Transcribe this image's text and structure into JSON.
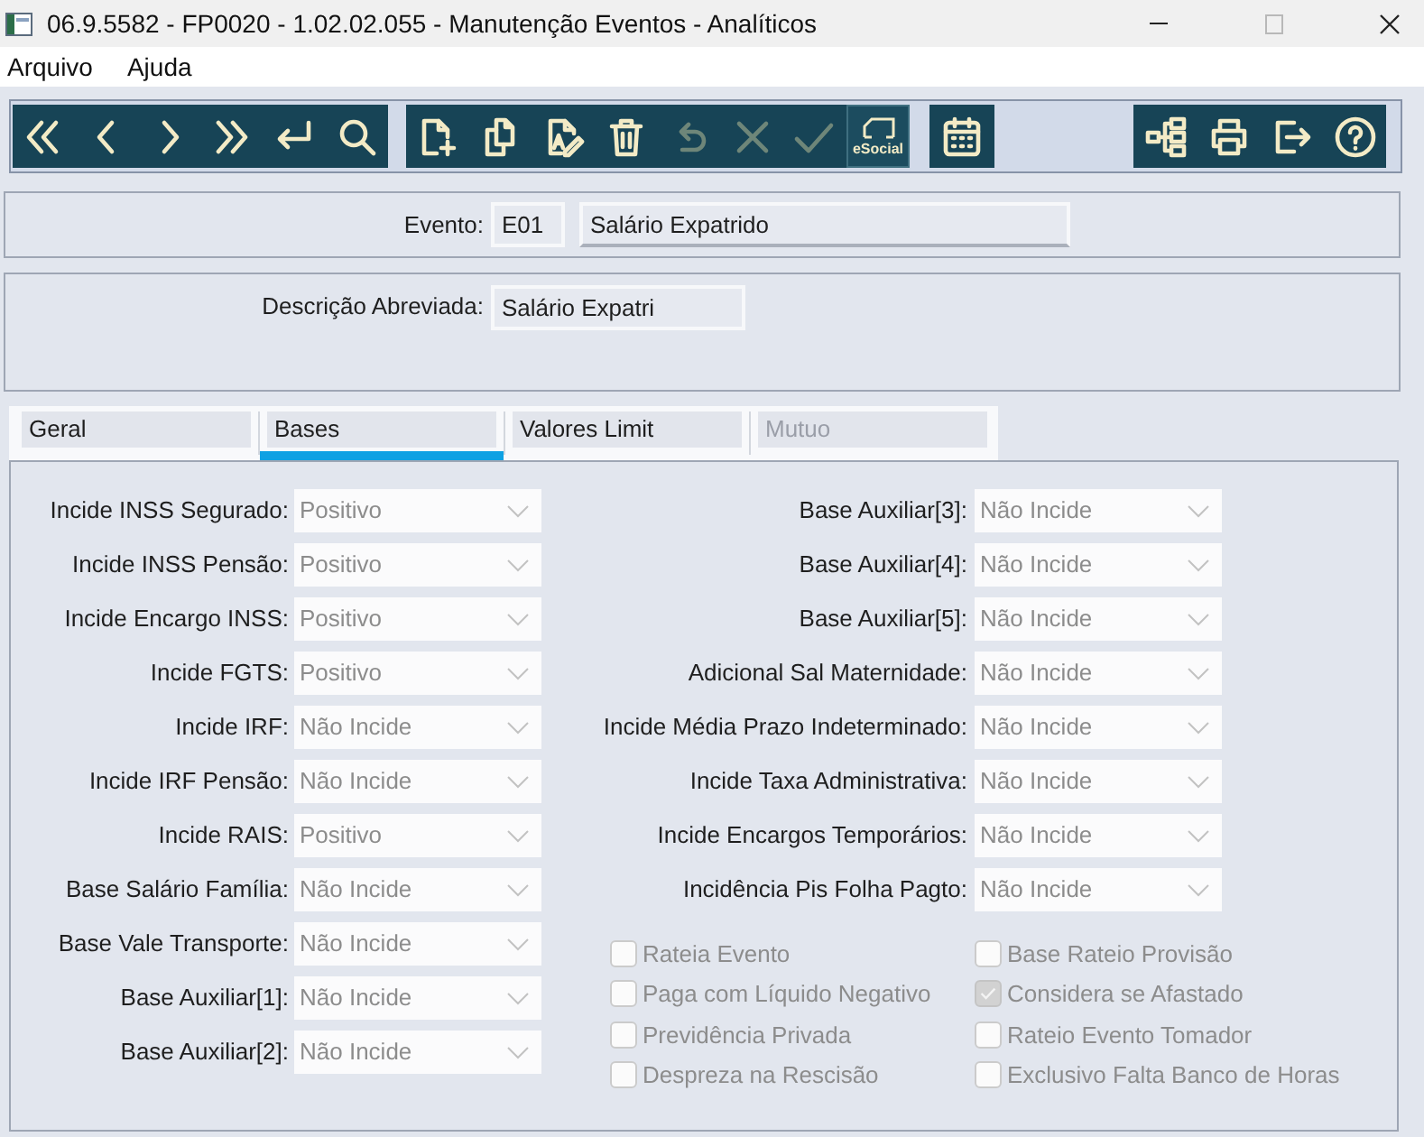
{
  "window": {
    "title": "06.9.5582 - FP0020 - 1.02.02.055 - Manutenção Eventos - Analíticos"
  },
  "menu": [
    "Arquivo",
    "Ajuda"
  ],
  "toolbar": {
    "groups": [
      {
        "buttons": [
          {
            "kind": "first",
            "disabled": false
          },
          {
            "kind": "previous",
            "disabled": false
          },
          {
            "kind": "next",
            "disabled": false
          },
          {
            "kind": "last",
            "disabled": false
          },
          {
            "kind": "enter",
            "disabled": false
          },
          {
            "kind": "search",
            "disabled": false
          }
        ]
      },
      {
        "buttons": [
          {
            "kind": "new",
            "disabled": false
          },
          {
            "kind": "copy",
            "disabled": false
          },
          {
            "kind": "edit",
            "disabled": false
          },
          {
            "kind": "delete",
            "disabled": false
          },
          {
            "kind": "undo",
            "disabled": true
          },
          {
            "kind": "cancel",
            "disabled": true
          },
          {
            "kind": "confirm",
            "disabled": true
          },
          {
            "kind": "esocial",
            "label": "eSocial",
            "disabled": false
          }
        ]
      },
      {
        "buttons": [
          {
            "kind": "calendar",
            "disabled": false
          }
        ]
      },
      {
        "buttons": [
          {
            "kind": "tree",
            "disabled": false
          },
          {
            "kind": "print",
            "disabled": false
          },
          {
            "kind": "exit",
            "disabled": false
          },
          {
            "kind": "help",
            "disabled": false
          }
        ]
      }
    ]
  },
  "event": {
    "label": "Evento:",
    "code": "E01",
    "name": "Salário Expatrido"
  },
  "short_description": {
    "label": "Descrição Abreviada:",
    "value": "Salário Expatri"
  },
  "tabs": [
    {
      "label": "Geral",
      "selected": false,
      "disabled": false
    },
    {
      "label": "Bases",
      "selected": true,
      "disabled": false
    },
    {
      "label": "Valores Limit",
      "selected": false,
      "disabled": false
    },
    {
      "label": "Mutuo",
      "selected": false,
      "disabled": true
    }
  ],
  "bases": {
    "left_fields": [
      {
        "label": "Incide INSS Segurado:",
        "value": "Positivo",
        "disabled": true
      },
      {
        "label": "Incide INSS Pensão:",
        "value": "Positivo",
        "disabled": true
      },
      {
        "label": "Incide Encargo INSS:",
        "value": "Positivo",
        "disabled": true
      },
      {
        "label": "Incide FGTS:",
        "value": "Positivo",
        "disabled": true
      },
      {
        "label": "Incide IRF:",
        "value": "Não Incide",
        "disabled": true
      },
      {
        "label": "Incide IRF Pensão:",
        "value": "Não Incide",
        "disabled": true
      },
      {
        "label": "Incide RAIS:",
        "value": "Positivo",
        "disabled": true
      },
      {
        "label": "Base Salário Família:",
        "value": "Não Incide",
        "disabled": true
      },
      {
        "label": "Base Vale Transporte:",
        "value": "Não Incide",
        "disabled": true
      },
      {
        "label": "Base Auxiliar[1]:",
        "value": "Não Incide",
        "disabled": true
      },
      {
        "label": "Base Auxiliar[2]:",
        "value": "Não Incide",
        "disabled": true
      }
    ],
    "right_fields": [
      {
        "label": "Base Auxiliar[3]:",
        "value": "Não Incide",
        "disabled": true
      },
      {
        "label": "Base Auxiliar[4]:",
        "value": "Não Incide",
        "disabled": true
      },
      {
        "label": "Base Auxiliar[5]:",
        "value": "Não Incide",
        "disabled": true
      },
      {
        "label": "Adicional Sal Maternidade:",
        "value": "Não Incide",
        "disabled": true
      },
      {
        "label": "Incide Média Prazo Indeterminado:",
        "value": "Não Incide",
        "disabled": true
      },
      {
        "label": "Incide Taxa Administrativa:",
        "value": "Não Incide",
        "disabled": true
      },
      {
        "label": "Incide Encargos Temporários:",
        "value": "Não Incide",
        "disabled": true
      },
      {
        "label": "Incidência Pis Folha Pagto:",
        "value": "Não Incide",
        "disabled": true
      }
    ],
    "checkbox_columns": [
      [
        {
          "label": "Rateia Evento",
          "checked": false,
          "disabled": true
        },
        {
          "label": "Paga com Líquido Negativo",
          "checked": false,
          "disabled": true
        },
        {
          "label": "Previdência Privada",
          "checked": false,
          "disabled": true
        },
        {
          "label": "Despreza na Rescisão",
          "checked": false,
          "disabled": true
        }
      ],
      [
        {
          "label": "Base Rateio Provisão",
          "checked": false,
          "disabled": true
        },
        {
          "label": "Considera se Afastado",
          "checked": true,
          "disabled": true
        },
        {
          "label": "Rateio Evento Tomador",
          "checked": false,
          "disabled": true
        },
        {
          "label": "Exclusivo Falta Banco de Horas",
          "checked": false,
          "disabled": true
        }
      ]
    ]
  }
}
